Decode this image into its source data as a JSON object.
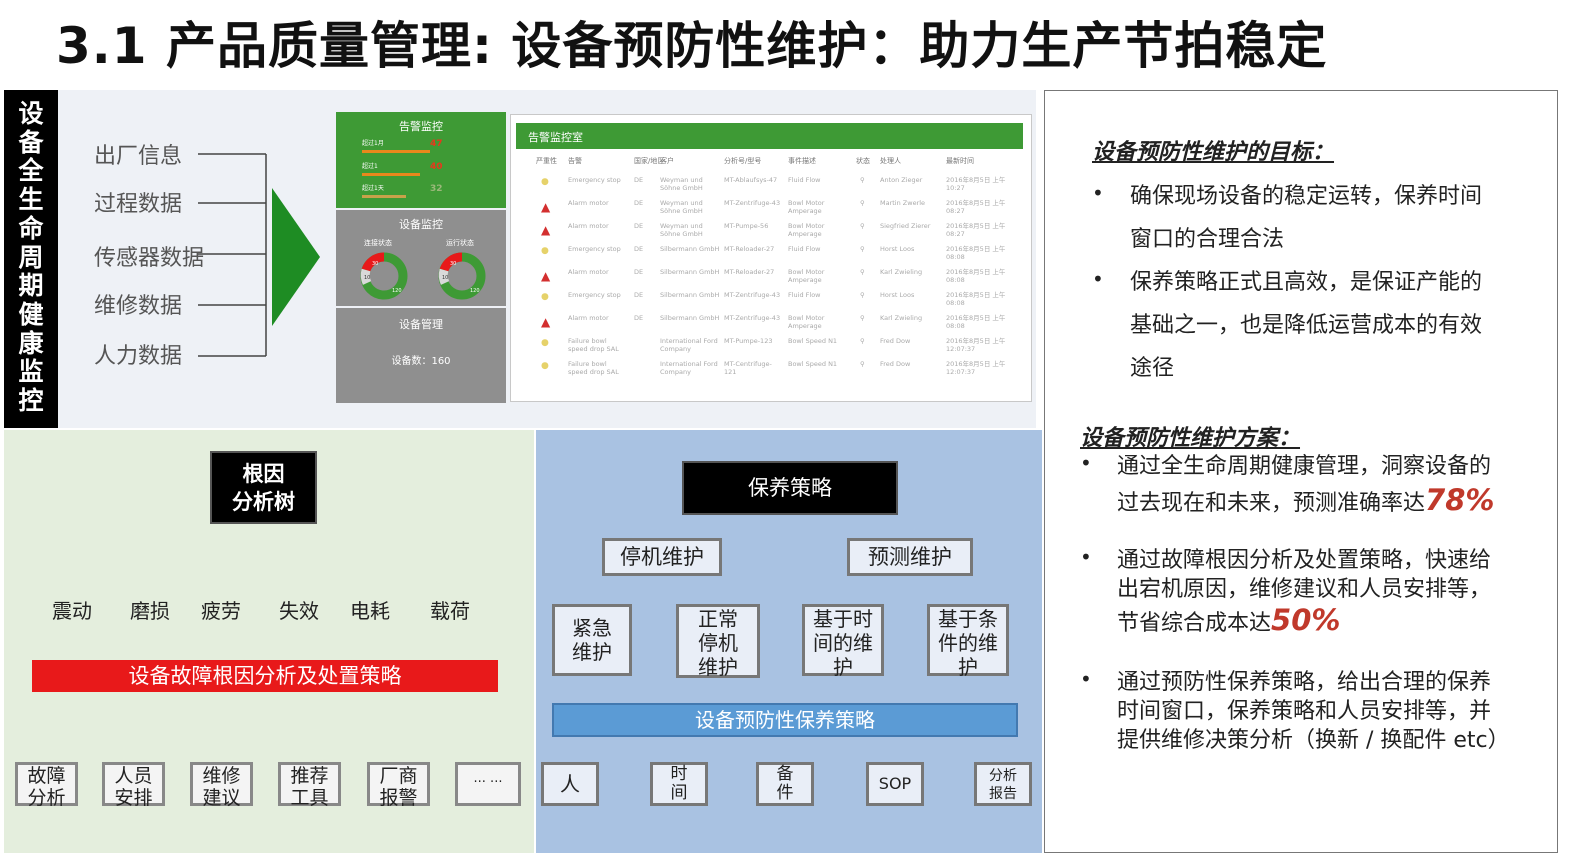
{
  "title": "3.1 产品质量管理: 设备预防性维护：助力生产节拍稳定",
  "vertical_label": [
    "设",
    "备",
    "全",
    "生",
    "命",
    "周",
    "期",
    "健",
    "康",
    "监",
    "控"
  ],
  "data_sources": [
    "出厂信息",
    "过程数据",
    "传感器数据",
    "维修数据",
    "人力数据"
  ],
  "dashboard": {
    "alert_title": "告警监控",
    "alerts": [
      {
        "label": "超过1月",
        "value": "47",
        "fill": 0.85
      },
      {
        "label": "超过1",
        "value": "40",
        "fill": 0.72
      },
      {
        "label": "超过1天",
        "value": "32",
        "fill": 0.55
      }
    ],
    "device_title": "设备监控",
    "gauges": [
      {
        "label": "连接状态",
        "red": "30",
        "gray": "10",
        "green": "120"
      },
      {
        "label": "运行状态",
        "red": "30",
        "gray": "10",
        "green": "120"
      }
    ],
    "mgmt_title": "设备管理",
    "device_count": "设备数：160",
    "room_title": "告警监控室",
    "table_headers": [
      "严重性",
      "告警",
      "国家/地区",
      "客户",
      "分析号/型号",
      "事件描述",
      "状态",
      "处理人",
      "最新时间"
    ],
    "table_rows": [
      {
        "sev": "warn",
        "c": [
          "Emergency stop",
          "DE",
          "Weyman und Söhne GmbH",
          "MT-Ablaufsys-47",
          "Fluid Flow",
          "Anton Zieger",
          "2016年8月5日 上午10:27"
        ]
      },
      {
        "sev": "alarm",
        "c": [
          "Alarm motor",
          "DE",
          "Weyman und Söhne GmbH",
          "MT-Zentrifuge-43",
          "Bowl Motor Amperage",
          "Martin Zwerle",
          "2016年8月5日 上午08:27"
        ]
      },
      {
        "sev": "alarm",
        "c": [
          "Alarm motor",
          "DE",
          "Weyman und Söhne GmbH",
          "MT-Pumpe-56",
          "Bowl Motor Amperage",
          "Siegfried Zierer",
          "2016年8月5日 上午08:27"
        ]
      },
      {
        "sev": "warn",
        "c": [
          "Emergency stop",
          "DE",
          "Silbermann GmbH",
          "MT-Reloader-27",
          "Fluid Flow",
          "Horst Loos",
          "2016年8月5日 上午08:08"
        ]
      },
      {
        "sev": "alarm",
        "c": [
          "Alarm motor",
          "DE",
          "Silbermann GmbH",
          "MT-Reloader-27",
          "Bowl Motor Amperage",
          "Karl Zwieling",
          "2016年8月5日 上午08:08"
        ]
      },
      {
        "sev": "warn",
        "c": [
          "Emergency stop",
          "DE",
          "Silbermann GmbH",
          "MT-Zentrifuge-43",
          "Fluid Flow",
          "Horst Loos",
          "2016年8月5日 上午08:08"
        ]
      },
      {
        "sev": "alarm",
        "c": [
          "Alarm motor",
          "DE",
          "Silbermann GmbH",
          "MT-Zentrifuge-43",
          "Bowl Motor Amperage",
          "Karl Zwieling",
          "2016年8月5日 上午08:08"
        ]
      },
      {
        "sev": "warn",
        "c": [
          "Failure bowl speed drop SAL",
          "",
          "International Ford Company",
          "MT-Pumpe-123",
          "Bowl Speed N1",
          "Fred Dow",
          "2016年8月5日 上午12:07:37"
        ]
      },
      {
        "sev": "warn",
        "c": [
          "Failure bowl speed drop SAL",
          "",
          "International Ford Company",
          "MT-Centrifuge-121",
          "Bowl Speed N1",
          "Fred Dow",
          "2016年8月5日 上午12:07:37"
        ]
      }
    ]
  },
  "root_cause": {
    "title_line1": "根因",
    "title_line2": "分析树",
    "causes": [
      "震动",
      "磨损",
      "疲劳",
      "失效",
      "电耗",
      "载荷"
    ],
    "bar": "设备故障根因分析及处置策略",
    "outputs": [
      [
        "故障",
        "分析"
      ],
      [
        "人员",
        "安排"
      ],
      [
        "维修",
        "建议"
      ],
      [
        "推荐",
        "工具"
      ],
      [
        "厂商",
        "报警"
      ],
      [
        "··· ···"
      ]
    ]
  },
  "maintenance": {
    "title": "保养策略",
    "branches": [
      "停机维护",
      "预测维护"
    ],
    "leaves": [
      [
        "紧急",
        "维护"
      ],
      [
        "正常",
        "停机",
        "维护"
      ],
      [
        "基于时",
        "间的维",
        "护"
      ],
      [
        "基于条",
        "件的维",
        "护"
      ]
    ],
    "bar": "设备预防性保养策略",
    "outputs": [
      [
        "人"
      ],
      [
        "时",
        "间"
      ],
      [
        "备",
        "件"
      ],
      [
        "SOP"
      ],
      [
        "分析",
        "报告"
      ]
    ]
  },
  "right": {
    "goal_heading": "设备预防性维护的目标：",
    "goals": [
      [
        "确保现场设备的稳定运转，保养时间",
        "窗口的合理合法"
      ],
      [
        "保养策略正式且高效，是保证产能的",
        "基础之一，也是降低运营成本的有效",
        "途径"
      ]
    ],
    "plan_heading": "设备预防性维护方案：",
    "plan1_line1": "通过全生命周期健康管理，洞察设备的",
    "plan1_line2": "过去现在和未来，预测准确率达",
    "plan1_highlight": "78%",
    "plan2_line1": "通过故障根因分析及处置策略，快速给",
    "plan2_line2": "出宕机原因，维修建议和人员安排等，",
    "plan2_line3": "节省综合成本达",
    "plan2_highlight": "50%",
    "plan3": [
      "通过预防性保养策略，给出合理的保养",
      "时间窗口，保养策略和人员安排等，并",
      "提供维修决策分析（换新 / 换配件 etc）"
    ]
  },
  "colors": {
    "green": "#3e9a35",
    "red": "#e8191a",
    "blue": "#5b9bd5",
    "highlight": "#c0392b"
  }
}
